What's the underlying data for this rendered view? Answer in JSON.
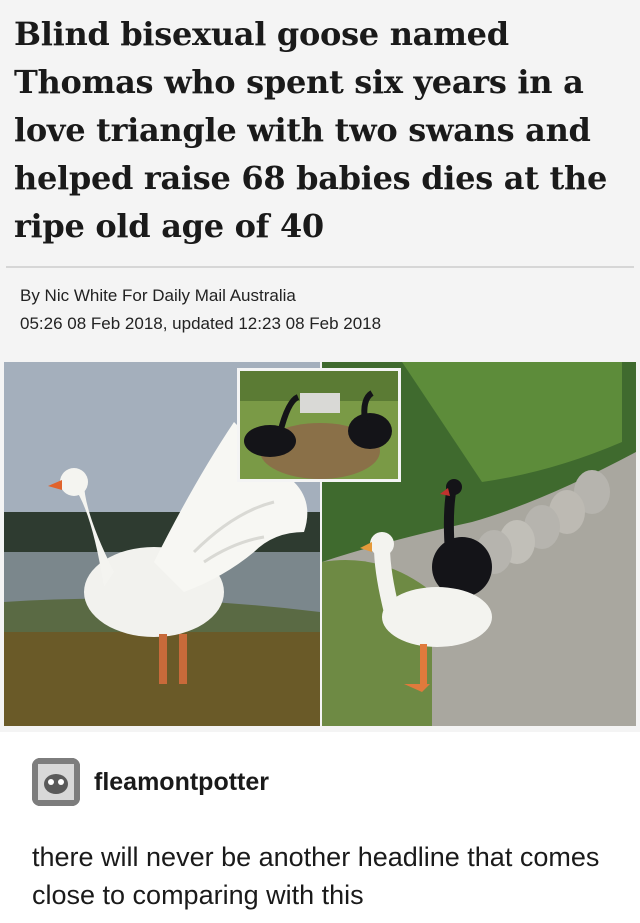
{
  "article": {
    "headline": "Blind bisexual goose named Thomas who spent six years in a love triangle with two swans and helped raise 68 babies dies at the ripe old age of 40",
    "byline": "By Nic White For Daily Mail Australia",
    "dateline": "05:26 08 Feb 2018, updated 12:23 08 Feb 2018"
  },
  "comment": {
    "username": "fleamontpotter",
    "text": "there will never be another headline that comes close to comparing with this"
  },
  "colors": {
    "background": "#ffffff",
    "article_bg": "#f4f4f4",
    "text": "#1a1a1a"
  }
}
